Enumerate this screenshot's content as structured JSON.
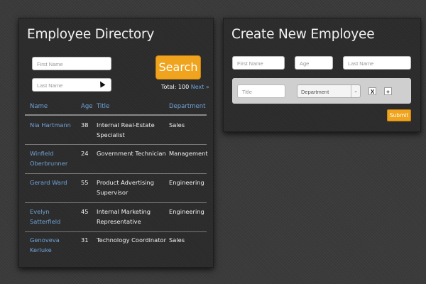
{
  "directory": {
    "title": "Employee Directory",
    "first_name_placeholder": "First Name",
    "last_name_placeholder": "Last Name",
    "search_label": "Search",
    "total_label": "Total: 100",
    "next_label": "Next »",
    "columns": [
      "Name",
      "Age",
      "Title",
      "Department"
    ],
    "rows": [
      {
        "name": "Nia Hartmann",
        "age": "38",
        "title": "Internal Real-Estate Specialist",
        "department": "Sales"
      },
      {
        "name": "Winfield Oberbrunner",
        "age": "24",
        "title": "Government Technician",
        "department": "Management"
      },
      {
        "name": "Gerard Ward",
        "age": "55",
        "title": "Product Advertising Supervisor",
        "department": "Engineering"
      },
      {
        "name": "Evelyn Satterfield",
        "age": "45",
        "title": "Internal Marketing Representative",
        "department": "Engineering"
      },
      {
        "name": "Genoveva Kerluke",
        "age": "31",
        "title": "Technology Coordinator",
        "department": "Sales"
      }
    ]
  },
  "create": {
    "title": "Create New Employee",
    "first_name_placeholder": "First Name",
    "age_placeholder": "Age",
    "last_name_placeholder": "Last Name",
    "title_placeholder": "Title",
    "department_selected": "Department",
    "remove_label": "X",
    "add_label": "+",
    "submit_label": "Submit"
  },
  "colors": {
    "accent": "#f0a41d",
    "link": "#6fa2d6",
    "panel_bg": "#2b2b2b",
    "page_bg": "#3a3a3a"
  }
}
